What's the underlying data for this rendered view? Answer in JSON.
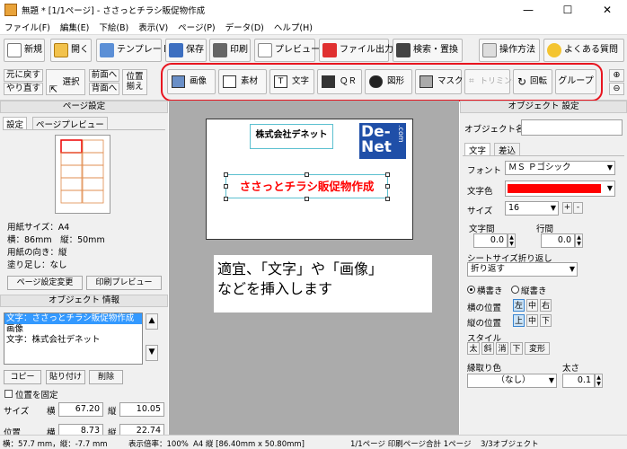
{
  "window": {
    "title": "無題 * [1/1ページ] - ささっとチラシ販促物作成",
    "minimize": "—",
    "maximize": "☐",
    "close": "✕"
  },
  "menu": [
    "ファイル(F)",
    "編集(E)",
    "下絵(B)",
    "表示(V)",
    "ページ(P)",
    "データ(D)",
    "ヘルプ(H)"
  ],
  "toolbar": {
    "new": "新規",
    "open": "開く",
    "template": "テンプレート",
    "save": "保存",
    "print": "印刷",
    "preview": "プレビュー",
    "export": "ファイル出力",
    "search_replace": "検索・置換",
    "howto": "操作方法",
    "faq": "よくある質問"
  },
  "edit_toolbar": {
    "undo": "元に戻す",
    "redo": "やり直す",
    "select": "選択",
    "front": "前面へ",
    "back": "背面へ",
    "align1": "位置",
    "align2": "揃え",
    "image": "画像",
    "material": "素材",
    "text": "文字",
    "qr": "ＱＲ",
    "shape": "図形",
    "mask": "マスク",
    "trim": "トリミング",
    "rotate": "回転",
    "group": "グループ"
  },
  "page_settings": {
    "header": "ページ設定",
    "tab_settings": "設定",
    "tab_preview": "ページプレビュー",
    "paper_size": "用紙サイズ：A4",
    "dims": "横：86mm　縦：50mm",
    "orientation": "用紙の向き：縦",
    "bleed": "塗り足し：なし",
    "change_btn": "ページ設定変更",
    "print_preview_btn": "印刷プレビュー"
  },
  "object_info": {
    "header": "オブジェクト 情報",
    "items": [
      "文字：ささっとチラシ販促物作成",
      "画像",
      "文字：株式会社デネット"
    ],
    "copy": "コピー",
    "paste": "貼り付け",
    "delete": "削除",
    "fix_position": "位置を固定",
    "size_label": "サイズ",
    "pos_label": "位置",
    "h": "横",
    "v": "縦",
    "size_w": "67.20",
    "size_h": "10.05",
    "pos_x": "8.73",
    "pos_y": "22.74"
  },
  "canvas": {
    "company": "株式会社デネット",
    "headline": "ささっとチラシ販促物作成",
    "logo_text": "De-Net",
    "logo_sub": ".com",
    "note_line1": "適宜、「文字」や「画像」",
    "note_line2": "などを挿入します"
  },
  "object_settings": {
    "header": "オブジェクト 設定",
    "name_label": "オブジェクト名",
    "tab_text": "文字",
    "tab_insert": "差込",
    "font_label": "フォント",
    "font_value": "ＭＳ Ｐゴシック",
    "color_label": "文字色",
    "color_hex": "#ff0000",
    "size_label": "サイズ",
    "size_value": "16",
    "plus": "+",
    "minus": "-",
    "char_spacing": "文字間",
    "line_spacing": "行間",
    "char_spacing_value": "0.0",
    "line_spacing_value": "0.0",
    "wrap_label": "シートサイズ折り返し",
    "wrap_value": "折り返す",
    "horizontal": "横書き",
    "vertical": "縦書き",
    "h_pos": "横の位置",
    "v_pos": "縦の位置",
    "left": "左",
    "center": "中",
    "right": "右",
    "top": "上",
    "middle": "中",
    "bottom": "下",
    "style_label": "スタイル",
    "bold": "太",
    "italic": "斜",
    "strike": "消",
    "underline": "下",
    "transform": "変形",
    "border_color_label": "縁取り色",
    "thickness_label": "太さ",
    "border_color_value": "（なし）",
    "thickness_value": "0.1"
  },
  "status": {
    "coords": "横：57.7 mm，縦：-7.7 mm",
    "zoom": "表示倍率：100%",
    "paper": "A4 縦 [86.40mm x 50.80mm]",
    "pages": "1/1ページ 印刷ページ合計 1ページ",
    "objects": "3/3オブジェクト"
  },
  "colors": {
    "accent_red": "#e8141f",
    "selection_blue": "#3399ff",
    "logo_blue": "#1f4fa8"
  }
}
